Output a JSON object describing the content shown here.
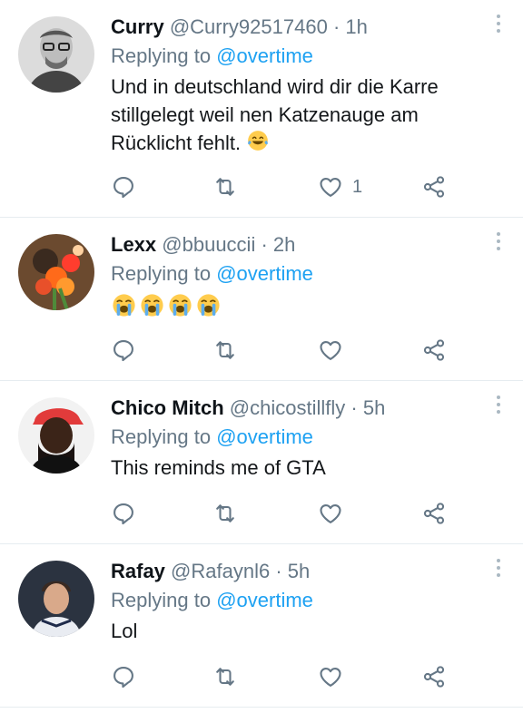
{
  "replies": [
    {
      "name": "Curry",
      "handle": "@Curry92517460",
      "separator": "·",
      "time": "1h",
      "replying_prefix": "Replying to",
      "replying_to": "@overtime",
      "text": "Und in deutschland wird dir die Karre stillgelegt weil nen Katzenauge am Rücklicht fehlt.",
      "emoji": "face-with-tears-of-joy",
      "like_count": "1"
    },
    {
      "name": "Lexx",
      "handle": "@bbuuccii",
      "separator": "·",
      "time": "2h",
      "replying_prefix": "Replying to",
      "replying_to": "@overtime",
      "emoji": "loudly-crying-face",
      "emoji_count": 4,
      "like_count": ""
    },
    {
      "name": "Chico Mitch",
      "handle": "@chicostillfly",
      "separator": "·",
      "time": "5h",
      "replying_prefix": "Replying to",
      "replying_to": "@overtime",
      "text": "This reminds me of GTA",
      "like_count": ""
    },
    {
      "name": "Rafay",
      "handle": "@Rafaynl6",
      "separator": "·",
      "time": "5h",
      "replying_prefix": "Replying to",
      "replying_to": "@overtime",
      "text": "Lol",
      "like_count": ""
    }
  ],
  "icons": {
    "reply": "reply-icon",
    "retweet": "retweet-icon",
    "like": "heart-icon",
    "share": "share-icon",
    "more": "more-options-icon"
  },
  "colors": {
    "mention": "#1da1f2",
    "secondary": "#657786",
    "divider": "#e6ecf0"
  }
}
